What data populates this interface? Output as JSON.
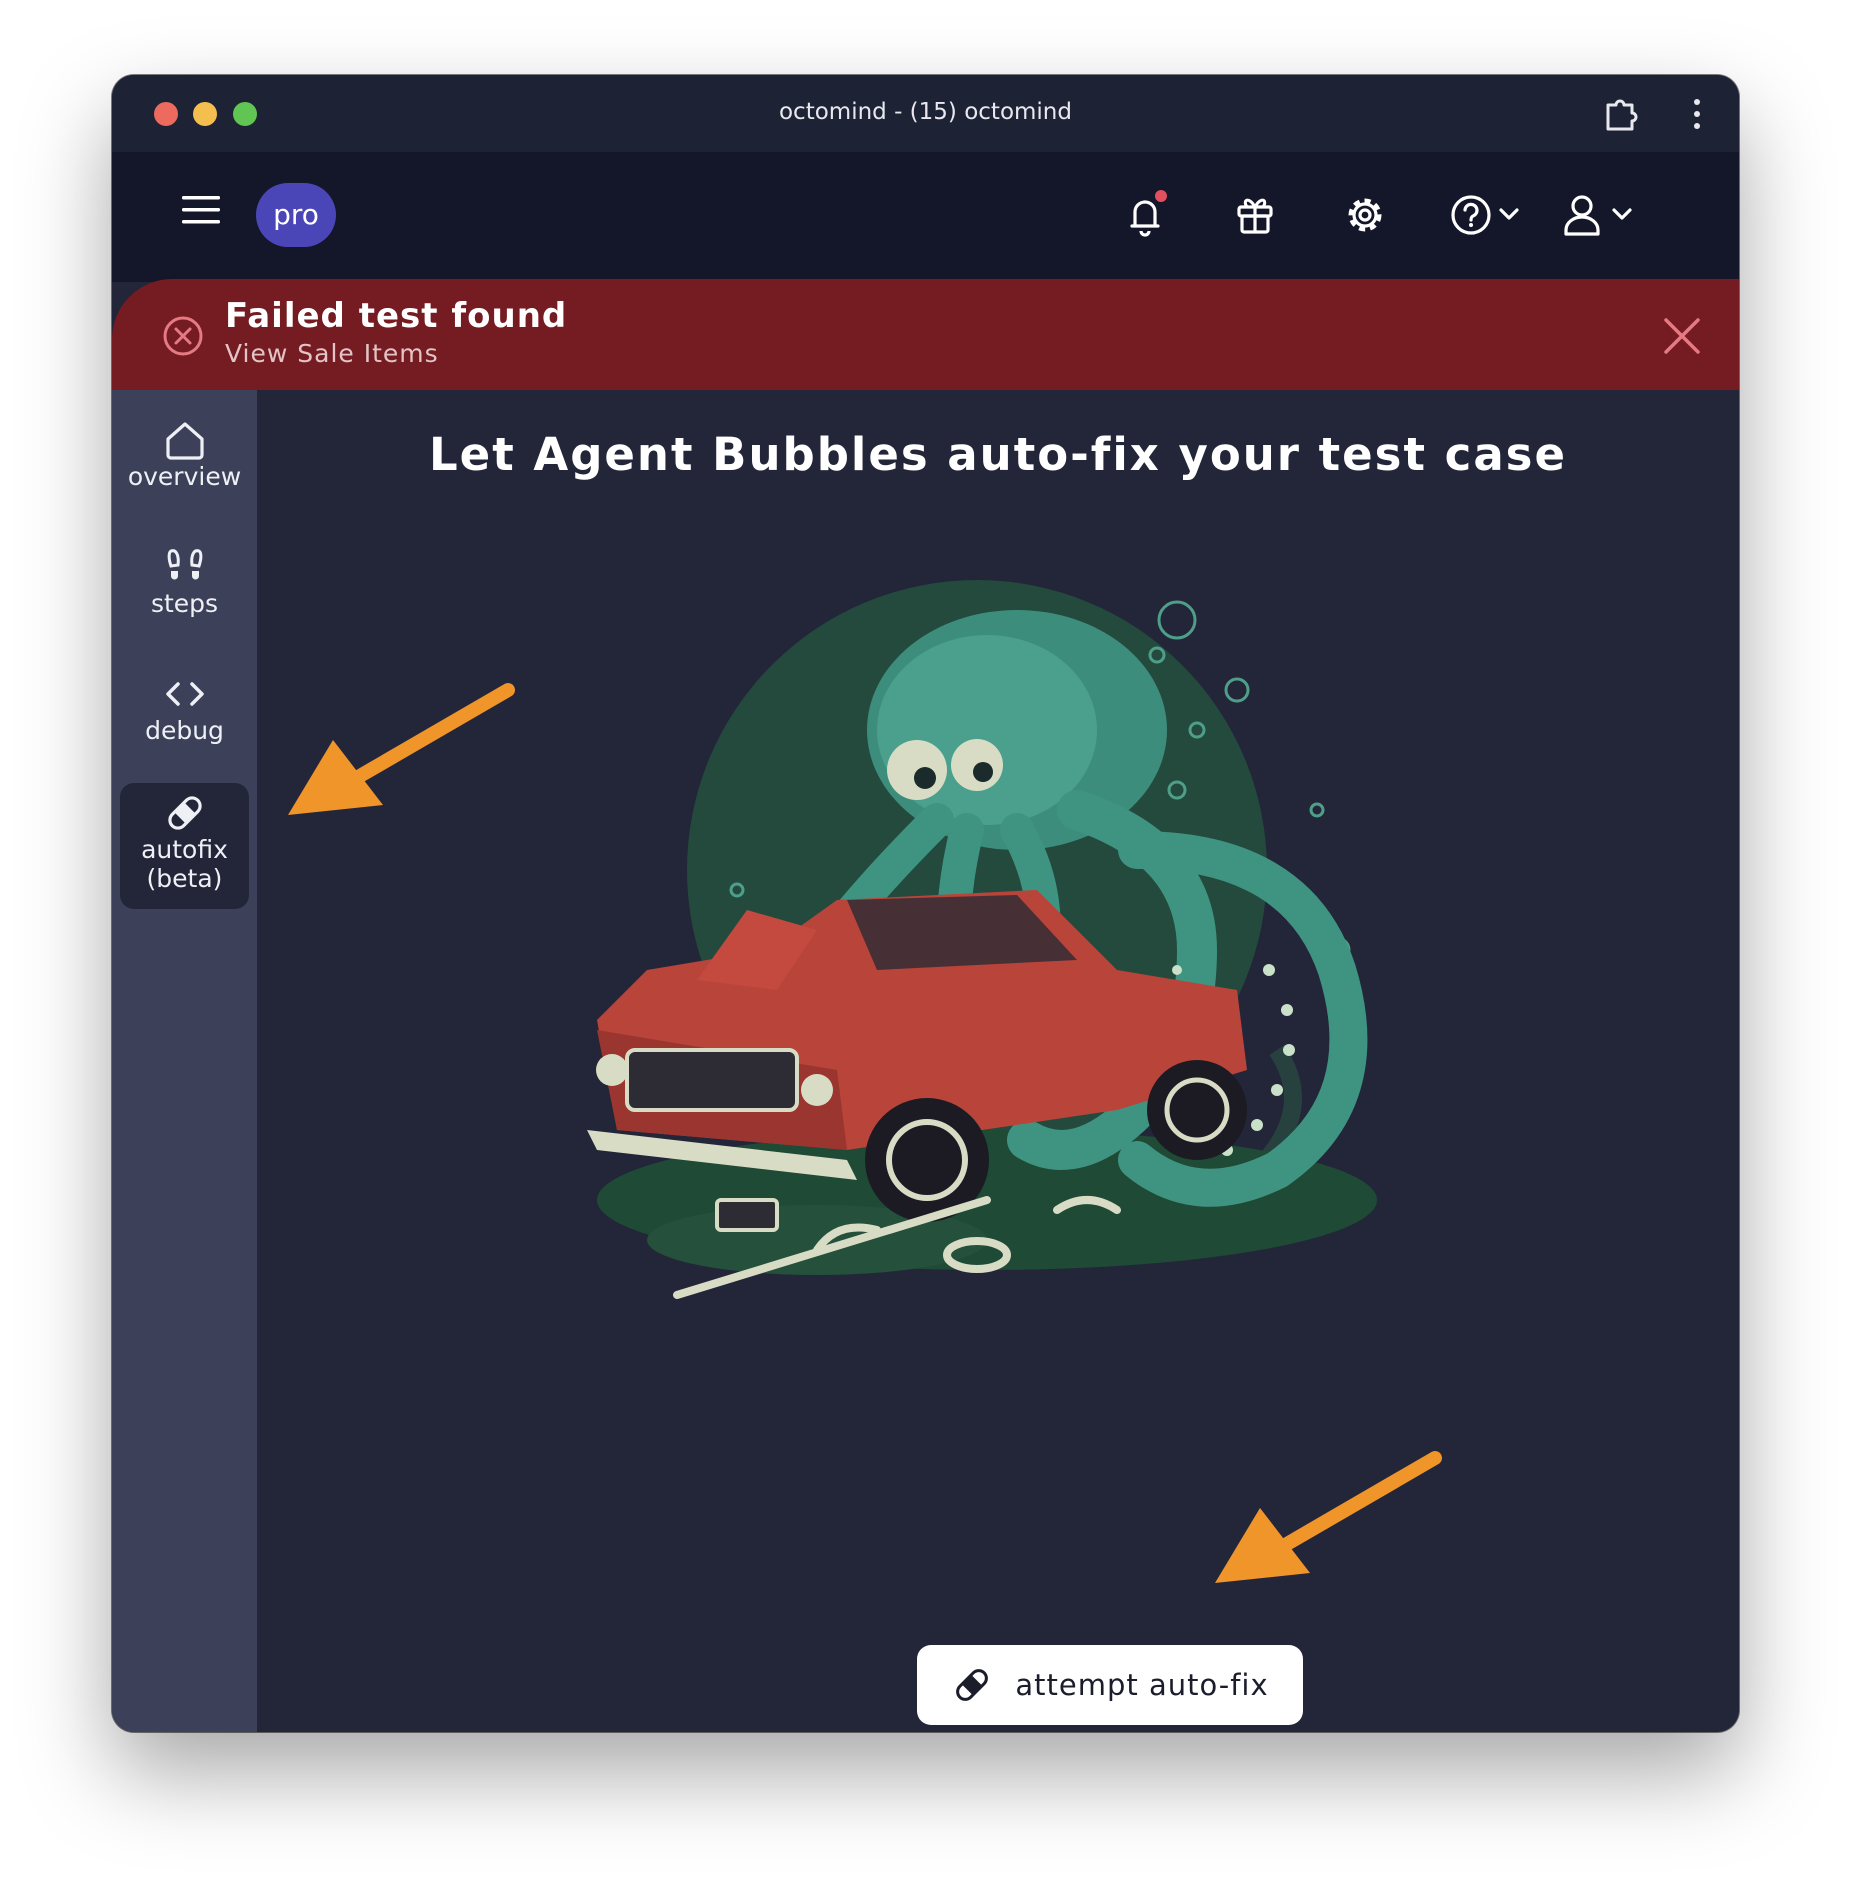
{
  "window": {
    "title": "octomind - (15) octomind"
  },
  "topnav": {
    "plan_badge": "pro",
    "icons": [
      "menu-icon",
      "bell-icon",
      "gift-icon",
      "gear-icon",
      "help-icon",
      "user-icon"
    ],
    "notification_dot_color": "#e0505e"
  },
  "banner": {
    "title": "Failed test found",
    "subtitle": "View Sale Items",
    "color": "#751b22"
  },
  "sidebar": {
    "items": [
      {
        "label": "overview",
        "icon": "home-icon"
      },
      {
        "label": "steps",
        "icon": "footsteps-icon"
      },
      {
        "label": "debug",
        "icon": "code-icon"
      },
      {
        "label": "autofix",
        "label2": "(beta)",
        "icon": "bandage-icon",
        "active": true
      }
    ]
  },
  "main": {
    "headline": "Let Agent Bubbles auto-fix your test case",
    "illustration": "octopus-repairing-car-illustration",
    "button_label": "attempt auto-fix"
  },
  "colors": {
    "accent_arrow": "#f0952a",
    "pro_badge": "#4b46b8",
    "sidebar": "#3c4058",
    "main_bg": "#232639"
  }
}
